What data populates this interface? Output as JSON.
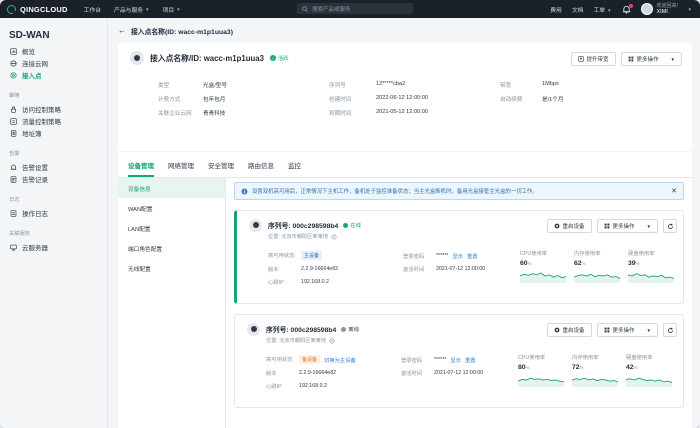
{
  "topbar": {
    "brand": "QINGCLOUD",
    "nav": [
      "工作台",
      "产品与服务",
      "项目"
    ],
    "search_placeholder": "搜索产品或服务",
    "links": [
      "费用",
      "文档",
      "工单"
    ],
    "user_greeting": "欢迎回来！",
    "user_name": "XIMI"
  },
  "sidebar": {
    "title": "SD-WAN",
    "groups": [
      {
        "heading": "",
        "items": [
          "概览",
          "连接云网",
          "接入点"
        ]
      },
      {
        "heading": "策略",
        "items": [
          "访问控制策略",
          "流量控制策略",
          "地址簿"
        ]
      },
      {
        "heading": "告警",
        "items": [
          "告警设置",
          "告警记录"
        ]
      },
      {
        "heading": "日志",
        "items": [
          "操作日志"
        ]
      },
      {
        "heading": "关联服务",
        "items": [
          "云服务器"
        ]
      }
    ],
    "active_item": "接入点"
  },
  "breadcrumb": "接入点名称(ID: wacc-m1p1uua3)",
  "detail": {
    "title": "接入点名称/ID: wacc-m1p1uua3",
    "status": "活跃",
    "upgrade_button": "提升带宽",
    "more_button": "更多操作",
    "rows": [
      [
        [
          "类型",
          "光盒/型号"
        ],
        [
          "序列号",
          "12*****cba2"
        ],
        [
          "带宽",
          "1Mbps"
        ]
      ],
      [
        [
          "计费方式",
          "包年包月"
        ],
        [
          "创建时间",
          "2022-06-12 12:00:00"
        ],
        [
          "自动续费",
          "是/1个月"
        ]
      ],
      [
        [
          "关联企业云网",
          "青青科技"
        ],
        [
          "到期时间",
          "2021-05-12 12:00:00"
        ],
        [
          "",
          ""
        ]
      ]
    ]
  },
  "tabs": [
    "设备管理",
    "网络管理",
    "安全管理",
    "路由信息",
    "监控"
  ],
  "active_tab": "设备管理",
  "subnav": [
    "设备信息",
    "WAN配置",
    "LAN配置",
    "端口角色配置",
    "无线配置"
  ],
  "active_subnav": "设备信息",
  "alert": "设置双机高可用后，正常情况下主机工作，备机处于监控准备状态；当主光盒断机时，备用光盒接管主光盒的一切工作。",
  "devices": [
    {
      "serial": "序列号: 000c298598b4",
      "state": "在线",
      "state_color": "#15a675",
      "location": "位置: 北京市朝阳区某某地",
      "reboot": "重启设备",
      "more": "更多操作",
      "ha_label": "高可用状态",
      "ha_tag": "主设备",
      "ha_link": "",
      "version_label": "版本",
      "version": "2.2.9-16664e82",
      "ip_label": "心跳IP",
      "ip": "192.168.0.2",
      "pwd_label": "登录密码",
      "pwd": "******",
      "show": "显示",
      "reset": "重置",
      "act_label": "激活时间",
      "act_time": "2021-07-12 12:00:00",
      "metrics": [
        {
          "label": "CPU使用率",
          "value": "60",
          "unit": "%",
          "spark": [
            0.5,
            0.65,
            0.55,
            0.7,
            0.6,
            0.75,
            0.5,
            0.6,
            0.4,
            0.55,
            0.35,
            0.45
          ]
        },
        {
          "label": "内存使用率",
          "value": "62",
          "unit": "%",
          "spark": [
            0.4,
            0.55,
            0.6,
            0.5,
            0.65,
            0.45,
            0.55,
            0.5,
            0.6,
            0.4,
            0.45,
            0.3
          ]
        },
        {
          "label": "硬盘使用率",
          "value": "39",
          "unit": "%",
          "spark": [
            0.6,
            0.5,
            0.7,
            0.55,
            0.6,
            0.4,
            0.5,
            0.45,
            0.55,
            0.35,
            0.4,
            0.3
          ]
        }
      ]
    },
    {
      "serial": "序列号: 000c298598b4",
      "state": "离线",
      "state_color": "#8b95a1",
      "location": "位置: 北京市朝阳区某某地",
      "reboot": "重启设备",
      "more": "更多操作",
      "ha_label": "高可用状态",
      "ha_tag": "备设备",
      "ha_link": "切换为主设备",
      "version_label": "版本",
      "version": "2.2.9-16664e82",
      "ip_label": "心跳IP",
      "ip": "192.168.0.2",
      "pwd_label": "登录密码",
      "pwd": "******",
      "show": "显示",
      "reset": "重置",
      "act_label": "激活时间",
      "act_time": "2021-07-12 12:00:00",
      "metrics": [
        {
          "label": "CPU使用率",
          "value": "80",
          "unit": "%",
          "spark": [
            0.4,
            0.55,
            0.5,
            0.65,
            0.55,
            0.6,
            0.5,
            0.55,
            0.45,
            0.5,
            0.4,
            0.35
          ]
        },
        {
          "label": "内存使用率",
          "value": "72",
          "unit": "%",
          "spark": [
            0.5,
            0.6,
            0.55,
            0.65,
            0.5,
            0.6,
            0.45,
            0.55,
            0.5,
            0.4,
            0.45,
            0.35
          ]
        },
        {
          "label": "硬盘使用率",
          "value": "42",
          "unit": "%",
          "spark": [
            0.55,
            0.6,
            0.5,
            0.65,
            0.55,
            0.45,
            0.5,
            0.4,
            0.5,
            0.35,
            0.4,
            0.3
          ]
        }
      ]
    }
  ]
}
